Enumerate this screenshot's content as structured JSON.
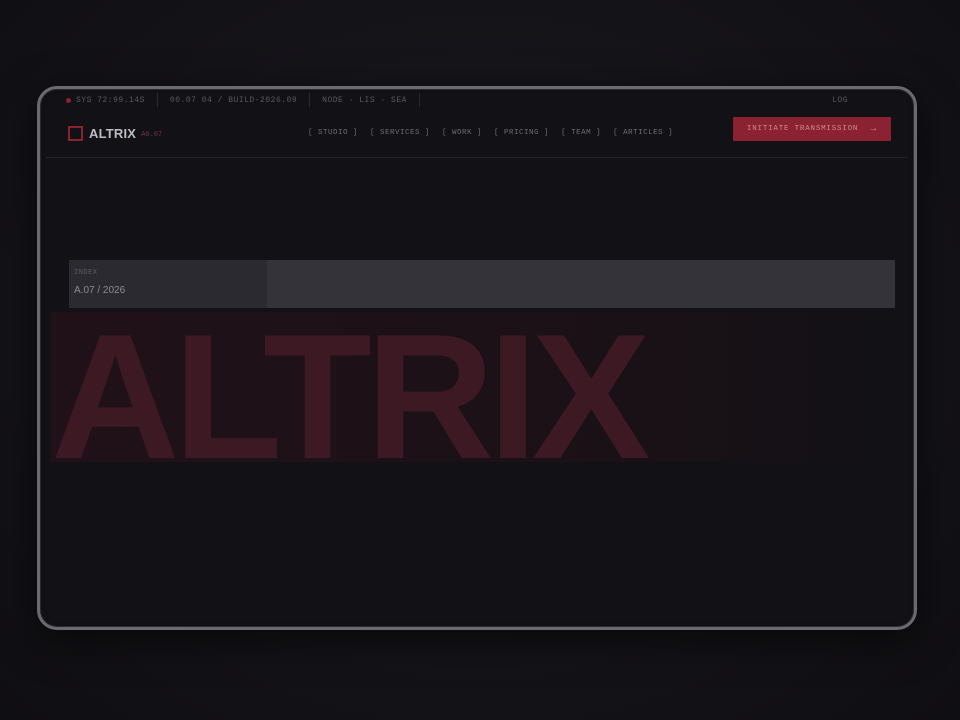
{
  "ticker": {
    "status": "SYS 72:99.14S",
    "version": "00.07 04 / BUILD-2026.09",
    "locations": "NODE · LIS · SEA",
    "right": "LOG"
  },
  "nav": {
    "logo_text": "ALTRIX",
    "logo_version": "A0.07",
    "menu": [
      {
        "label": "[ STUDIO ]"
      },
      {
        "label": "[ SERVICES ]"
      },
      {
        "label": "[ WORK ]"
      },
      {
        "label": "[ PRICING ]"
      },
      {
        "label": "[ TEAM ]"
      },
      {
        "label": "[ ARTICLES ]"
      }
    ],
    "cta_label": "INITIATE TRANSMISSION",
    "cta_icon": "arrow-right-icon"
  },
  "index": {
    "label": "INDEX",
    "value": "A.07 / 2026"
  },
  "hero": {
    "title": "ALTRIX"
  },
  "colors": {
    "accent": "#8a2232",
    "background": "#121116",
    "panel": "#34333a"
  }
}
